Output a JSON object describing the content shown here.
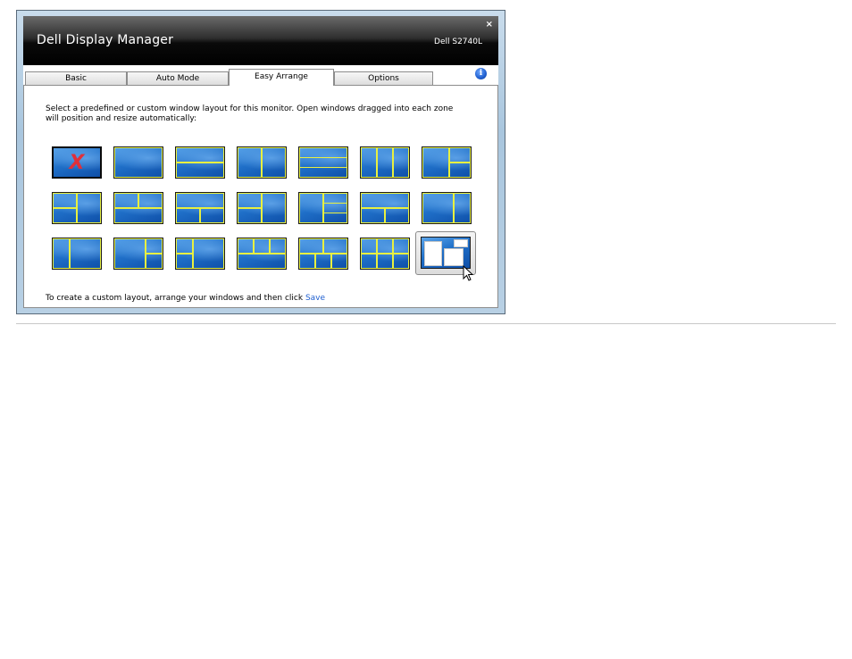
{
  "window": {
    "app_title": "Dell Display Manager",
    "monitor_model": "Dell S2740L",
    "close_glyph": "×"
  },
  "tabs": [
    {
      "label": "Basic",
      "active": false
    },
    {
      "label": "Auto Mode",
      "active": false
    },
    {
      "label": "Easy Arrange",
      "active": true
    },
    {
      "label": "Options",
      "active": false
    }
  ],
  "info_icon": {
    "name": "info-icon",
    "glyph": "i"
  },
  "easy_arrange": {
    "instructions": "Select a predefined or custom window layout for this monitor. Open windows dragged into each zone will position and resize automatically:",
    "layouts": [
      {
        "id": "none",
        "icon": "no-layout-x-icon"
      },
      {
        "id": "full"
      },
      {
        "id": "2-rows"
      },
      {
        "id": "2-cols"
      },
      {
        "id": "3-rows"
      },
      {
        "id": "3-cols"
      },
      {
        "id": "left-full-right-2rows"
      },
      {
        "id": "left-wide-right-narrow"
      },
      {
        "id": "top-left-wide-plus-row"
      },
      {
        "id": "bottom-split-2"
      },
      {
        "id": "top-split-2"
      },
      {
        "id": "right-col-3-stack"
      },
      {
        "id": "2x2-skew"
      },
      {
        "id": "right-wide"
      },
      {
        "id": "left-narrow-right-wide"
      },
      {
        "id": "left-right-2rows"
      },
      {
        "id": "left-2rows-right-full"
      },
      {
        "id": "top-3-bottom-full"
      },
      {
        "id": "top-2-bottom-3"
      },
      {
        "id": "grid-2x3"
      },
      {
        "id": "custom",
        "selected": true,
        "icon": "custom-layout-icon"
      }
    ],
    "footer_text": "To create a custom layout, arrange your windows and then click ",
    "save_link": "Save"
  }
}
